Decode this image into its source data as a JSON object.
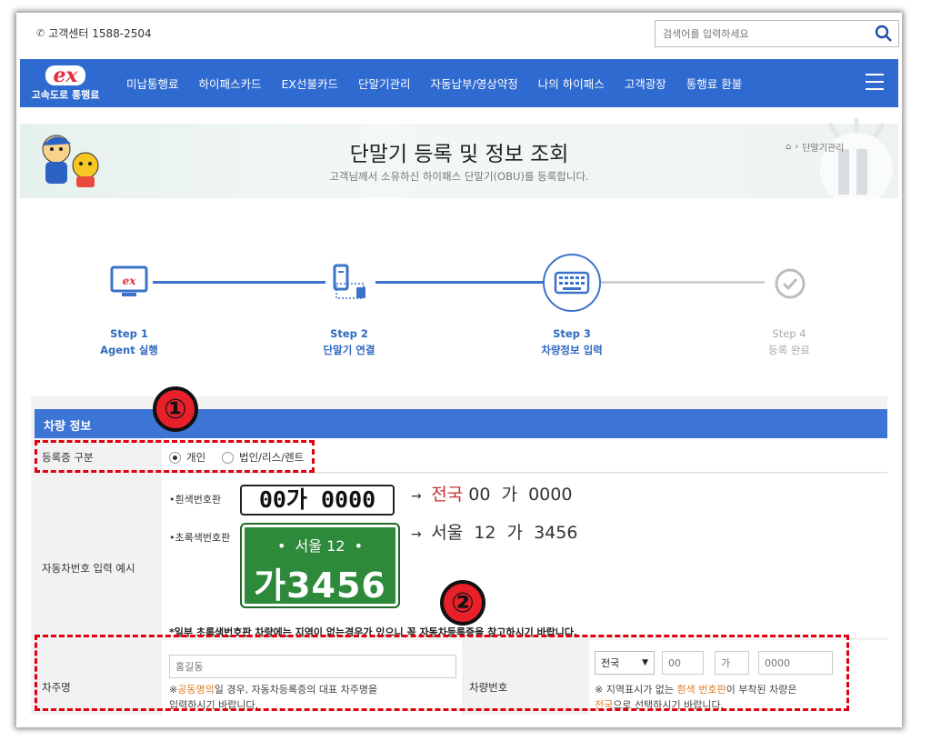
{
  "topbar": {
    "customer_center": "고객센터 1588-2504",
    "search_placeholder": "검색어를 입력하세요"
  },
  "nav": {
    "logo_mark": "ex",
    "logo_text": "고속도로 통행료",
    "items": [
      "미납통행료",
      "하이패스카드",
      "EX선불카드",
      "단말기관리",
      "자동납부/영상약정",
      "나의 하이패스",
      "고객광장",
      "통행료 환불"
    ]
  },
  "banner": {
    "title": "단말기 등록 및 정보 조회",
    "subtitle": "고객님께서 소유하신 하이패스 단말기(OBU)를 등록합니다.",
    "breadcrumb": "단말기관리"
  },
  "steps": [
    {
      "step": "Step 1",
      "name": "Agent 실행",
      "state": "done"
    },
    {
      "step": "Step 2",
      "name": "단말기 연결",
      "state": "done"
    },
    {
      "step": "Step 3",
      "name": "차량정보 입력",
      "state": "active"
    },
    {
      "step": "Step 4",
      "name": "등록 완료",
      "state": "pending"
    }
  ],
  "form": {
    "header": "차량 정보",
    "reg_type_label": "등록증 구분",
    "reg_type_options": [
      "개인",
      "법인/리스/렌트"
    ],
    "reg_type_selected": "개인",
    "example_label": "자동차번호 입력 예시",
    "white_plate_label": "•흰색번호판",
    "white_plate_text": "00가 0000",
    "white_example": {
      "region": "전국",
      "rest": "00  가  0000"
    },
    "green_plate_label": "•초록색번호판",
    "green_plate_top": "•  서울 12  •",
    "green_plate_bottom": "가3456",
    "green_example": "서울  12  가  3456",
    "bottom_note": "*일부 초록색번호판 차량에는 지역이 없는경우가 있으니 꼭 자동차등록증을 참고하시기 바랍니다.",
    "owner_label": "차주명",
    "owner_placeholder": "홍길동",
    "owner_note_pre": "※",
    "owner_note_hl": "공동명의",
    "owner_note_post": "일 경우, 자동차등록증의 대표 차주명을",
    "owner_note_line2": "입력하시기 바랍니다.",
    "car_number_label": "차량번호",
    "region_selected": "전국",
    "num1_placeholder": "00",
    "num2_placeholder": "가",
    "num3_placeholder": "0000",
    "car_note_pre": "※ 지역표시가 없는 ",
    "car_note_hl": "흰색 번호판",
    "car_note_post": "이 부착된 차량은",
    "car_note_hl2": "전국",
    "car_note_line2": "으로 선택하시기 바랍니다."
  },
  "annotations": [
    "①",
    "②"
  ],
  "colors": {
    "nav": "#2f6ad0",
    "header": "#3c75d6",
    "accent_red": "#e00010",
    "highlight": "#e07b22"
  }
}
